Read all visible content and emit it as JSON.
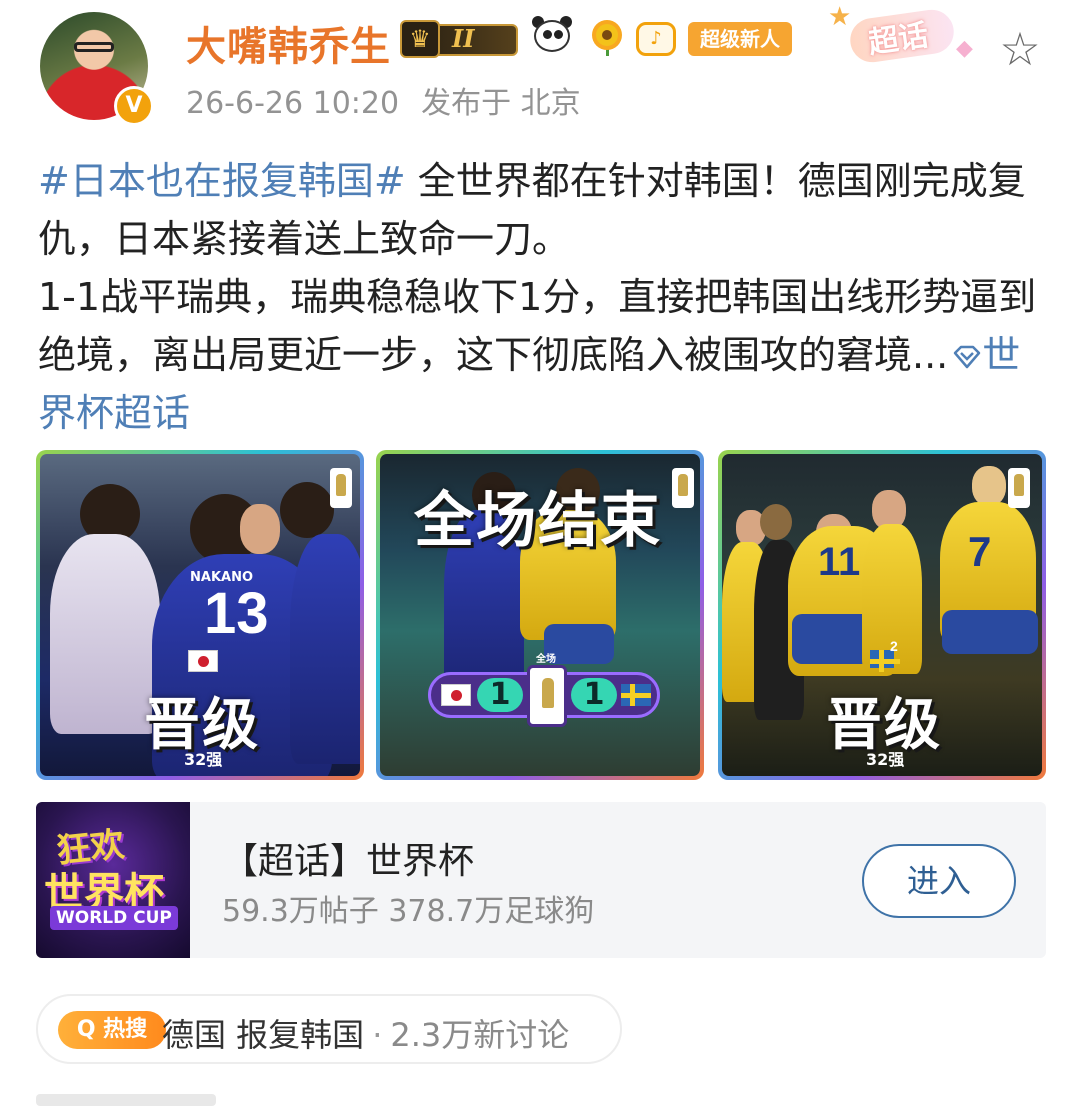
{
  "post": {
    "author": "大嘴韩乔生",
    "level_badge": "II",
    "user_badge_label": "超级新人",
    "chaohua_deco_label": "超话",
    "verified_mark": "V",
    "timestamp": "26-6-26 10:20",
    "location": "发布于 北京",
    "hashtag": "#日本也在报复韩国#",
    "text_part1": " 全世界都在针对韩国！德国刚完成复仇，日本紧接着送上致命一刀。",
    "text_part2": "1-1战平瑞典，瑞典稳稳收下1分，直接把韩国出线形势逼到绝境，离出局更近一步，这下彻底陷入被围攻的窘境...",
    "link_label": "世界杯超话"
  },
  "images": [
    {
      "headline": "晋级",
      "caption": "32强",
      "jersey_number": "13",
      "back_name": "NAKANO"
    },
    {
      "headline": "全场结束",
      "home_score": "1",
      "away_score": "1",
      "logo_caption": "全场"
    },
    {
      "headline": "晋级",
      "caption": "32强",
      "jersey_number_1": "11",
      "jersey_number_2": "7",
      "small_number": "2"
    }
  ],
  "card": {
    "title": "【超话】世界杯",
    "stats": "59.3万帖子 378.7万足球狗",
    "button": "进入",
    "image_line1": "狂欢",
    "image_line2": "世界杯",
    "image_line3": "WORLD CUP"
  },
  "hot_search": {
    "badge": "Q 热搜",
    "topic": "德国 报复韩国",
    "separator": "·",
    "meta": "2.3万新讨论"
  },
  "icons": {
    "favorite": "star-outline-icon",
    "link": "diamond-icon",
    "colors": {
      "accent_orange": "#e8752a",
      "link_blue": "#4f7fb6",
      "button_blue": "#3f73a8"
    }
  }
}
